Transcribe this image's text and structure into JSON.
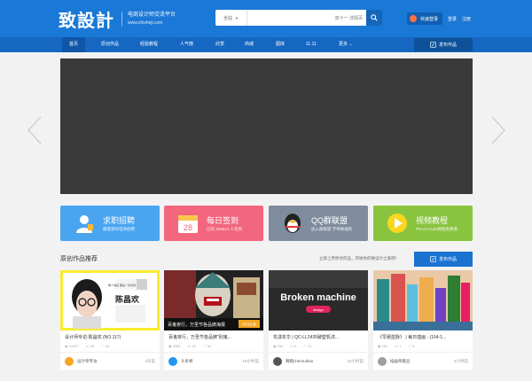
{
  "brand": {
    "mark": "致設計",
    "tagline": "电商设计师交流平台",
    "url": "www.zhisheji.com"
  },
  "search": {
    "category": "全站",
    "placeholder": "双十一  详情页"
  },
  "user": {
    "login": "快速登录",
    "signin": "登录",
    "register": "注册"
  },
  "nav": {
    "items": [
      "首页",
      "原创作品",
      "经验教程",
      "人气榜",
      "欣赏",
      "商城",
      "图库",
      "11.11",
      "更多"
    ],
    "publish": "发布作品"
  },
  "features": [
    {
      "title": "求职招聘",
      "sub": "最靠谱的电商招聘",
      "color": "#4aa5f0"
    },
    {
      "title": "每日签到",
      "sub": "已有 225512 人签到",
      "color": "#f2677e"
    },
    {
      "title": "QQ群联盟",
      "sub": "加入群联盟 学特殊福利",
      "color": "#7f8c9e"
    },
    {
      "title": "视频教程",
      "sub": "PS+AI+C4D教程免费看",
      "color": "#8ac43f"
    }
  ],
  "section": {
    "title": "原创作品推荐",
    "tip": "立即上传原创作品，开始你的致设计之旅吧！",
    "publish": "发布作品"
  },
  "cards": [
    {
      "title": "设计师专访-陈昌欢 (NO.117)",
      "views": "10467",
      "comments": "99",
      "likes": "44",
      "author": "设计师专访",
      "time": "2天前"
    },
    {
      "title": "百鬼夜行，万圣节各品牌\"别鬼...",
      "views": "2256",
      "comments": "16",
      "likes": "42",
      "author": "头条君",
      "time": "19小时前"
    },
    {
      "title": "花漾年华 | QC-LL2435破壁机详...",
      "views": "254",
      "comments": "6",
      "likes": "12",
      "author": "啊晒chenruihao",
      "time": "23小时前"
    },
    {
      "title": "《早晨蓝脉》 | 每日插画 - (164-1...",
      "views": "281",
      "comments": "1",
      "likes": "5",
      "author": "插画师嘉豆",
      "time": "4小时前"
    }
  ],
  "card_overlays": {
    "c1_name": "陈昌欢",
    "c1_text": "每个诚实 都是一次时间",
    "c2_title": "百鬼夜行，万圣节各品牌海报",
    "c2_badge": "今日头条",
    "c3_title": "Broken machine",
    "c3_sub": "design"
  }
}
